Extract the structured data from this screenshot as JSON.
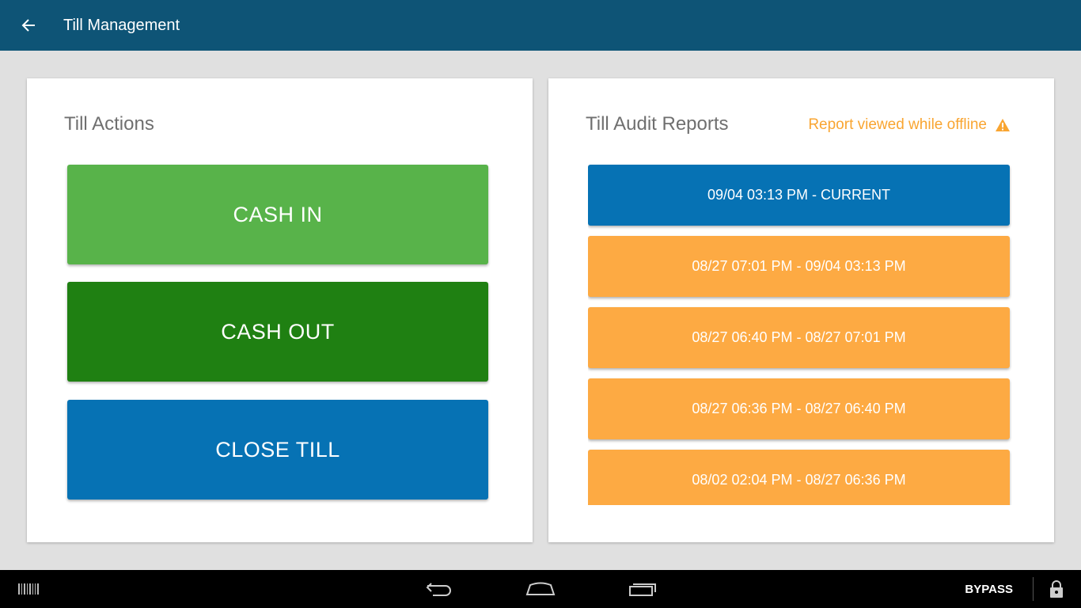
{
  "appbar": {
    "title": "Till Management",
    "back_icon": "arrow-left-icon",
    "color": "#0e5476"
  },
  "till_actions": {
    "title": "Till Actions",
    "buttons": [
      {
        "label": "CASH IN",
        "color": "#58b34a"
      },
      {
        "label": "CASH OUT",
        "color": "#1f8012"
      },
      {
        "label": "CLOSE TILL",
        "color": "#0672b4"
      }
    ]
  },
  "audit_reports": {
    "title": "Till Audit Reports",
    "offline_note": "Report viewed while offline",
    "offline_icon": "warning-icon",
    "items": [
      {
        "label": "09/04 03:13 PM - CURRENT",
        "color": "#0672b4"
      },
      {
        "label": "08/27 07:01 PM - 09/04 03:13 PM",
        "color": "#fdaa43"
      },
      {
        "label": "08/27 06:40 PM - 08/27 07:01 PM",
        "color": "#fdaa43"
      },
      {
        "label": "08/27 06:36 PM - 08/27 06:40 PM",
        "color": "#fdaa43"
      },
      {
        "label": "08/02 02:04 PM - 08/27 06:36 PM",
        "color": "#fdaa43"
      }
    ]
  },
  "system_bar": {
    "bypass_label": "BYPASS",
    "icons": [
      "barcode-icon",
      "back-nav-icon",
      "home-icon",
      "recents-icon",
      "lock-icon"
    ]
  }
}
